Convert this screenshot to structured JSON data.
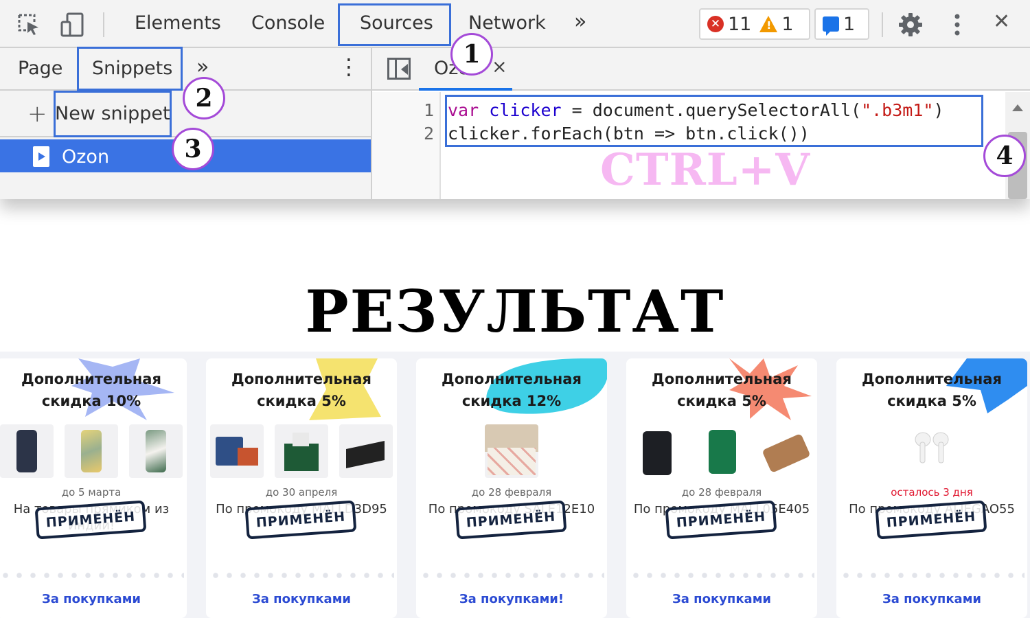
{
  "devtools": {
    "toolbar": {
      "inspect_icon": "inspect-element-icon",
      "device_icon": "device-toolbar-icon",
      "tabs": [
        "Elements",
        "Console",
        "Sources",
        "Network"
      ],
      "more_tabs": "»",
      "errors": "11",
      "warnings": "1",
      "messages": "1",
      "settings_icon": "gear-icon",
      "menu_icon": "kebab-menu-icon",
      "close": "✕"
    },
    "left_pane": {
      "tabs": [
        "Page",
        "Snippets"
      ],
      "more_tabs": "»",
      "menu": "⋮",
      "new_snippet_plus": "+",
      "new_snippet": "New snippet",
      "selected_file": "Ozon"
    },
    "editor": {
      "tab_name": "Ozon",
      "tab_close": "×",
      "line_numbers": [
        "1",
        "2"
      ],
      "line1": {
        "kw": "var",
        "name": "clicker",
        "rest1": " = document.querySelectorAll(",
        "str": "\".b3m1\"",
        "rest2": ")"
      },
      "line2": "clicker.forEach(btn => btn.click())"
    },
    "annotations": {
      "steps": [
        "1",
        "2",
        "3",
        "4"
      ],
      "hint": "CTRL+V",
      "highlight_color": "#3a6fd8",
      "circle_color": "#a44ad8"
    }
  },
  "result_title": "РЕЗУЛЬТАТ",
  "cards": [
    {
      "title_line1": "Дополнительная",
      "title_line2": "скидка 10%",
      "date": "до 5 марта",
      "desc": "На товары прямиком из Индии!",
      "stamp": "ПРИМЕНЁН",
      "cta": "За покупками",
      "blob_color": "#a5b6f4"
    },
    {
      "title_line1": "Дополнительная",
      "title_line2": "скидка 5%",
      "date": "до 30 апреля",
      "desc": "По промокоду MALLD3D95",
      "stamp": "ПРИМЕНЁН",
      "cta": "За покупками",
      "blob_color": "#f5e36f"
    },
    {
      "title_line1": "Дополнительная",
      "title_line2": "скидка 12%",
      "date": "до 28 февраля",
      "desc": "По промокоду SALE12E10",
      "stamp": "ПРИМЕНЁН",
      "cta": "За покупками!",
      "blob_color": "#3ed0e6"
    },
    {
      "title_line1": "Дополнительная",
      "title_line2": "скидка 5%",
      "date": "до 28 февраля",
      "desc": "По промокоду MALL05E405",
      "stamp": "ПРИМЕНЁН",
      "cta": "За покупками",
      "blob_color": "#f58a72"
    },
    {
      "title_line1": "Дополнительная",
      "title_line2": "скидка 5%",
      "date": "осталось 3 дня",
      "desc": "По промокоду ALIEGAO55",
      "stamp": "ПРИМЕНЁН",
      "cta": "За покупками",
      "blob_color": "#2f8df0"
    }
  ]
}
